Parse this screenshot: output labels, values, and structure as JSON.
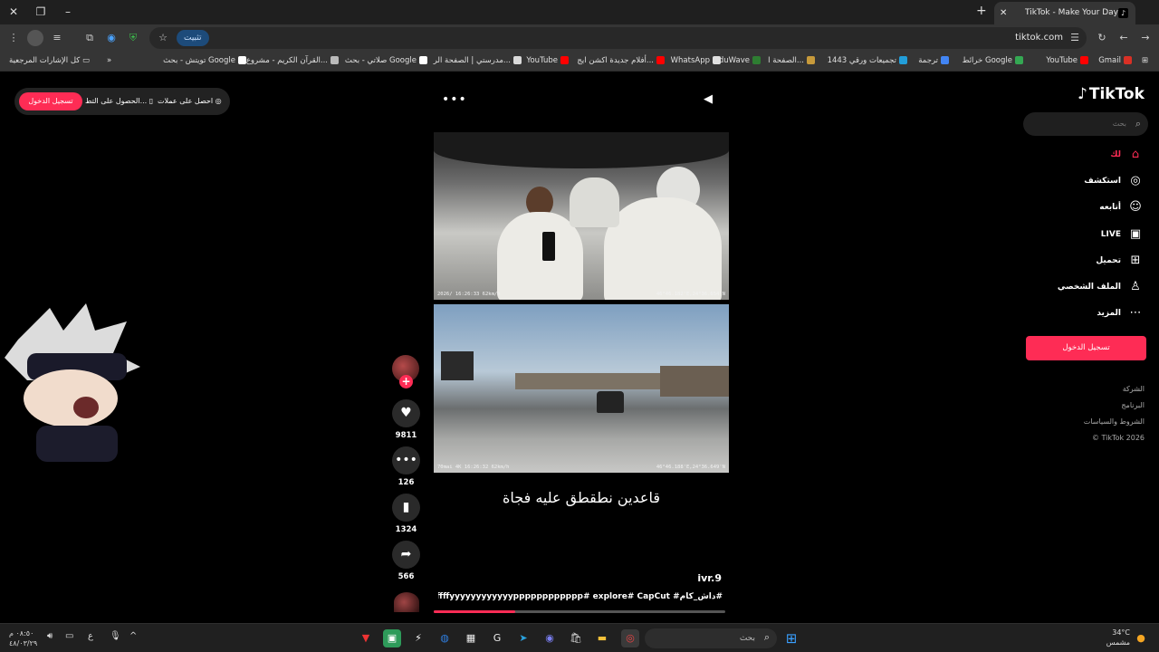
{
  "browser": {
    "tab_title": "TikTok - Make Your Day",
    "url": "tiktok.com",
    "install_label": "تثبيت",
    "bookmarks": [
      "Gmail",
      "YouTube",
      "خرائط Google",
      "ترجمة",
      "تجميعات ورقي 1443",
      "الصفحة ا...",
      "EduWave",
      "WhatsApp",
      "أفلام جديدة اكشن ايج...",
      "YouTube",
      "مدرستي | الصفحة الر...",
      "صلاتي - بحث Google",
      "القرآن الكريم - مشروع...",
      "تويتش - بحث Google"
    ],
    "all_bookmarks": "كل الإشارات المرجعية"
  },
  "tiktok": {
    "logo": "TikTok",
    "search_placeholder": "بحث",
    "nav": [
      {
        "label": "لك",
        "icon": "home-icon",
        "active": true
      },
      {
        "label": "استكشف",
        "icon": "compass-icon",
        "active": false
      },
      {
        "label": "أتابعه",
        "icon": "following-icon",
        "active": false
      },
      {
        "label": "LIVE",
        "icon": "live-icon",
        "active": false
      },
      {
        "label": "تحميل",
        "icon": "upload-icon",
        "active": false
      },
      {
        "label": "الملف الشخصي",
        "icon": "profile-icon",
        "active": false
      },
      {
        "label": "المزيد",
        "icon": "more-icon",
        "active": false
      }
    ],
    "login_button": "تسجيل الدخول",
    "footer": [
      "الشركة",
      "البرنامج",
      "الشروط والسياسات",
      "© TikTok 2026"
    ],
    "top_pill": {
      "login": "تسجيل الدخول",
      "get_app": "الحصول على التط...",
      "get_coins": "احصل على عملات"
    },
    "video": {
      "caption": "قاعدين نطقطق عليه فجاة",
      "author": "ivr.9",
      "description": "#داش_كام# ffffffffffyyyyyyyyyyyypppppppppppp# explore# CapCut #",
      "progress": 0.28,
      "dash_top_left": "2026/  16:26:33  62km/h",
      "dash_top_right": "46°46.182'E,24°36.654'N",
      "dash_bottom_left": "70mai 4K   16:26:32   62km/h",
      "dash_bottom_right": "46°46.188'E,24°36.649'N"
    },
    "actions": {
      "likes": "9811",
      "comments": "126",
      "saves": "1324",
      "shares": "566"
    }
  },
  "taskbar": {
    "search_placeholder": "بحث",
    "weather_temp": "34°C",
    "weather_desc": "مشمس",
    "time": "٠٨:٥٠ م",
    "date": "٤٨/٠٣/٢٩",
    "lang": "ع"
  }
}
